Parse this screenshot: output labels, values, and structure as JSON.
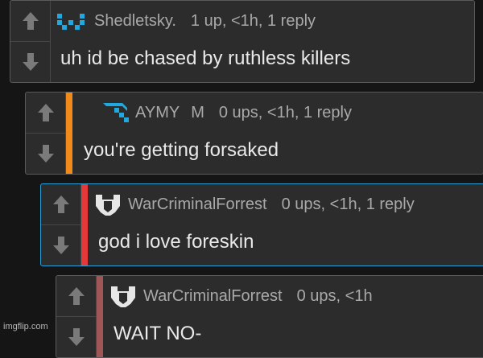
{
  "colors": {
    "background": "#151515",
    "panel": "#2c2c2c",
    "selected_border": "#2a9fd6",
    "accent_orange": "#f28a1a",
    "accent_red": "#e53838",
    "accent_maroon": "#a05656",
    "mod_icon_blue": "#20a9e0"
  },
  "comments": [
    {
      "author": "Shedletsky.",
      "badge": "",
      "meta": "1 up, <1h, 1 reply",
      "text": "uh id be chased by ruthless killers",
      "icon": "blue-pixel-smile-icon",
      "accent": ""
    },
    {
      "author": "AYMY",
      "badge": "M",
      "meta": "0 ups, <1h, 1 reply",
      "text": "you're getting forsaked",
      "icon": "blue-pickaxe-icon",
      "accent": "#f28a1a"
    },
    {
      "author": "WarCriminalForrest",
      "badge": "",
      "meta": "0 ups, <1h, 1 reply",
      "text": "god i love foreskin",
      "icon": "white-shield-icon",
      "accent": "#e53838",
      "selected": true
    },
    {
      "author": "WarCriminalForrest",
      "badge": "",
      "meta": "0 ups, <1h",
      "text": "WAIT NO-",
      "icon": "white-shield-icon",
      "accent": "#a05656"
    }
  ],
  "watermark": "imgflip.com"
}
